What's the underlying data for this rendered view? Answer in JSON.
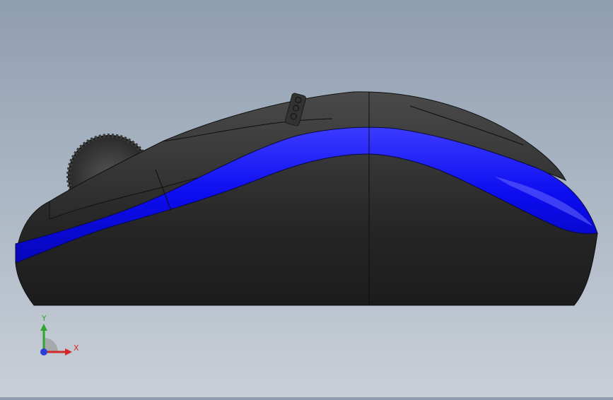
{
  "viewport": {
    "model": "computer-mouse-side-view",
    "body_color": "#2b2b2b",
    "stripe_color": "#1010e8",
    "background_top": "#8f9db0",
    "background_bottom": "#c9cfd7"
  },
  "triad": {
    "y_label": "Y",
    "x_label": "X",
    "y_color": "#2fa52f",
    "x_color": "#d22828",
    "z_color": "#2a3fd8"
  }
}
